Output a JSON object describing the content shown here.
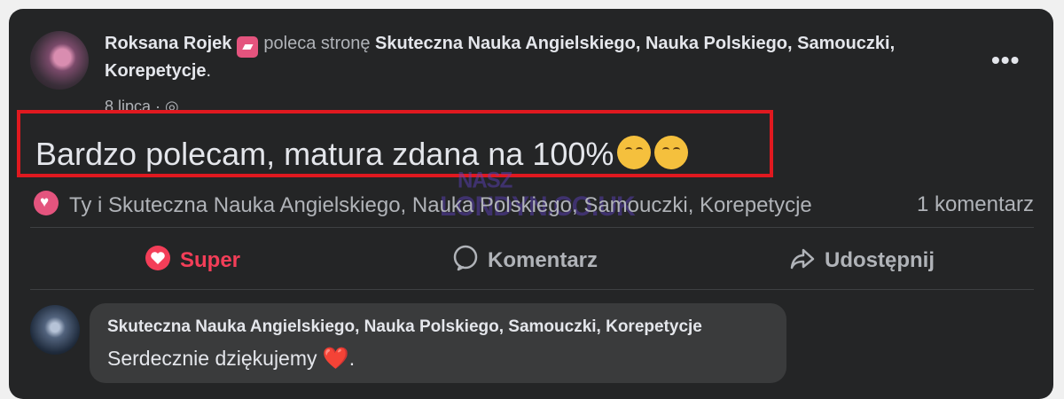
{
  "post": {
    "author": "Roksana Rojek",
    "action": "poleca stronę",
    "page_name": "Skuteczna Nauka Angielskiego, Nauka Polskiego, Samouczki, Korepetycje",
    "period": ".",
    "date": "8 lipca · ",
    "text": "Bardzo polecam, matura zdana na 100%",
    "reaction_text": "Ty i Skuteczna Nauka Angielskiego, Nauka Polskiego, Samouczki, Korepetycje",
    "comments_count": "1 komentarz",
    "more_icon": "more-horizontal-icon",
    "globe_icon": "globe-icon"
  },
  "actions": {
    "super": "Super",
    "comment": "Komentarz",
    "share": "Udostępnij"
  },
  "comment": {
    "author": "Skuteczna Nauka Angielskiego, Nauka Polskiego, Samouczki, Korepetycje",
    "text": "Serdecznie dziękujemy ",
    "heart": "❤️",
    "period": "."
  },
  "watermark": {
    "line1": "NASZ",
    "line2": "LONDYN.CO.UK"
  },
  "colors": {
    "card": "#242526",
    "highlight": "#e0191f",
    "super": "#f33e58"
  }
}
